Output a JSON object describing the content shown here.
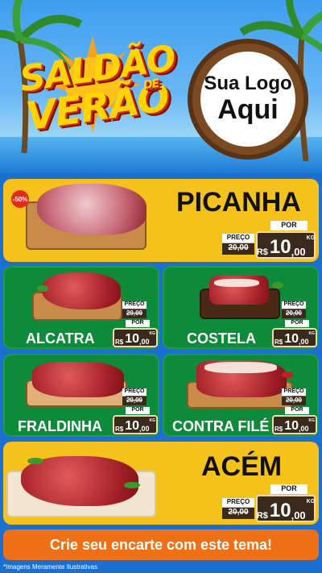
{
  "hero": {
    "title_line1": "SALDÃO",
    "title_line2": "VERÃO",
    "title_de": "DE",
    "logo_line1": "Sua Logo",
    "logo_line2": "Aqui"
  },
  "labels": {
    "preco": "PREÇO",
    "por": "POR",
    "currency": "R$",
    "kg": "KG"
  },
  "discount_badge": "-50%",
  "products": [
    {
      "name": "PICANHA",
      "old_price": "20,00",
      "new_int": "10",
      "new_dec": ",00"
    },
    {
      "name": "ALCATRA",
      "old_price": "20,00",
      "new_int": "10",
      "new_dec": ",00"
    },
    {
      "name": "COSTELA",
      "old_price": "20,00",
      "new_int": "10",
      "new_dec": ",00"
    },
    {
      "name": "FRALDINHA",
      "old_price": "20,00",
      "new_int": "10",
      "new_dec": ",00"
    },
    {
      "name": "CONTRA FILÉ",
      "old_price": "20,00",
      "new_int": "10",
      "new_dec": ",00"
    },
    {
      "name": "ACÉM",
      "old_price": "20,00",
      "new_int": "10",
      "new_dec": ",00"
    }
  ],
  "cta": "Crie seu encarte com este tema!",
  "disclaimer": "*Imagens Meramente Ilustrativas",
  "colors": {
    "yellow": "#f5c21b",
    "green": "#0d8a3a",
    "orange": "#f07018",
    "sky": "#3f9ef0"
  }
}
